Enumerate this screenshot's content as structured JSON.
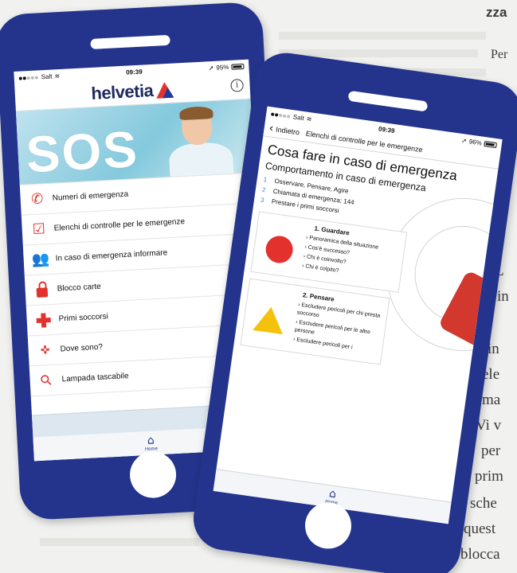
{
  "colors": {
    "phone_frame": "#24348c",
    "accent_red": "#e3322d",
    "step_blue": "#3a8fd1",
    "warning_yellow": "#f4c20d",
    "brand_navy": "#1f2a5e"
  },
  "background_text": {
    "top": [
      "zza",
      "Per"
    ],
    "right": [
      "L",
      "in",
      "in",
      "ele",
      "ma",
      "Vi v",
      "per",
      "prim",
      "sche",
      "quest",
      "blocca"
    ]
  },
  "phone1": {
    "status": {
      "carrier": "Salt",
      "time": "09:39",
      "battery": "95%"
    },
    "header": {
      "brand": "helvetia",
      "logo_icon": "helvetia-triangle-logo",
      "info_icon": "info-icon"
    },
    "hero": {
      "text": "SOS"
    },
    "menu": [
      {
        "label": "Numeri di emergenza",
        "icon": "phone-icon"
      },
      {
        "label": "Elenchi di controlle per le emergenze",
        "icon": "checklist-icon"
      },
      {
        "label": "In caso di emergenza informare",
        "icon": "people-icon"
      },
      {
        "label": "Blocco carte",
        "icon": "lock-icon"
      },
      {
        "label": "Primi soccorsi",
        "icon": "first-aid-cross-icon"
      },
      {
        "label": "Dove sono?",
        "icon": "location-icon"
      },
      {
        "label": "Lampada tascabile",
        "icon": "flashlight-icon"
      }
    ],
    "tabbar": {
      "home_label": "Home",
      "icon": "home-icon"
    }
  },
  "phone2": {
    "status": {
      "carrier": "Salt",
      "time": "09:39",
      "battery": "96%"
    },
    "nav": {
      "back_label": "Indietro",
      "title": "Elenchi di controlle per le emergenze"
    },
    "title": "Cosa fare in caso di emergenza",
    "subtitle": "Comportamento in caso di emergenza",
    "steps": [
      {
        "num": "1",
        "text": "Osservare, Pensare, Agire"
      },
      {
        "num": "2",
        "text": "Chiamata di emergenza: 144"
      },
      {
        "num": "3",
        "text": "Prestare i primi soccorsi"
      }
    ],
    "cards": [
      {
        "title": "1. Guardare",
        "items": [
          "Panoramica della situazione",
          "Cos'è successo?",
          "Chi è coinvolto?",
          "Chi è colpito?"
        ]
      },
      {
        "title": "2. Pensare",
        "items": [
          "Escludere pericoli per chi presta soccorso",
          "Escludere pericoli per le altre persone",
          "Escludere pericoli per i"
        ]
      }
    ],
    "tabbar": {
      "home_label": "Home",
      "icon": "home-icon"
    }
  }
}
